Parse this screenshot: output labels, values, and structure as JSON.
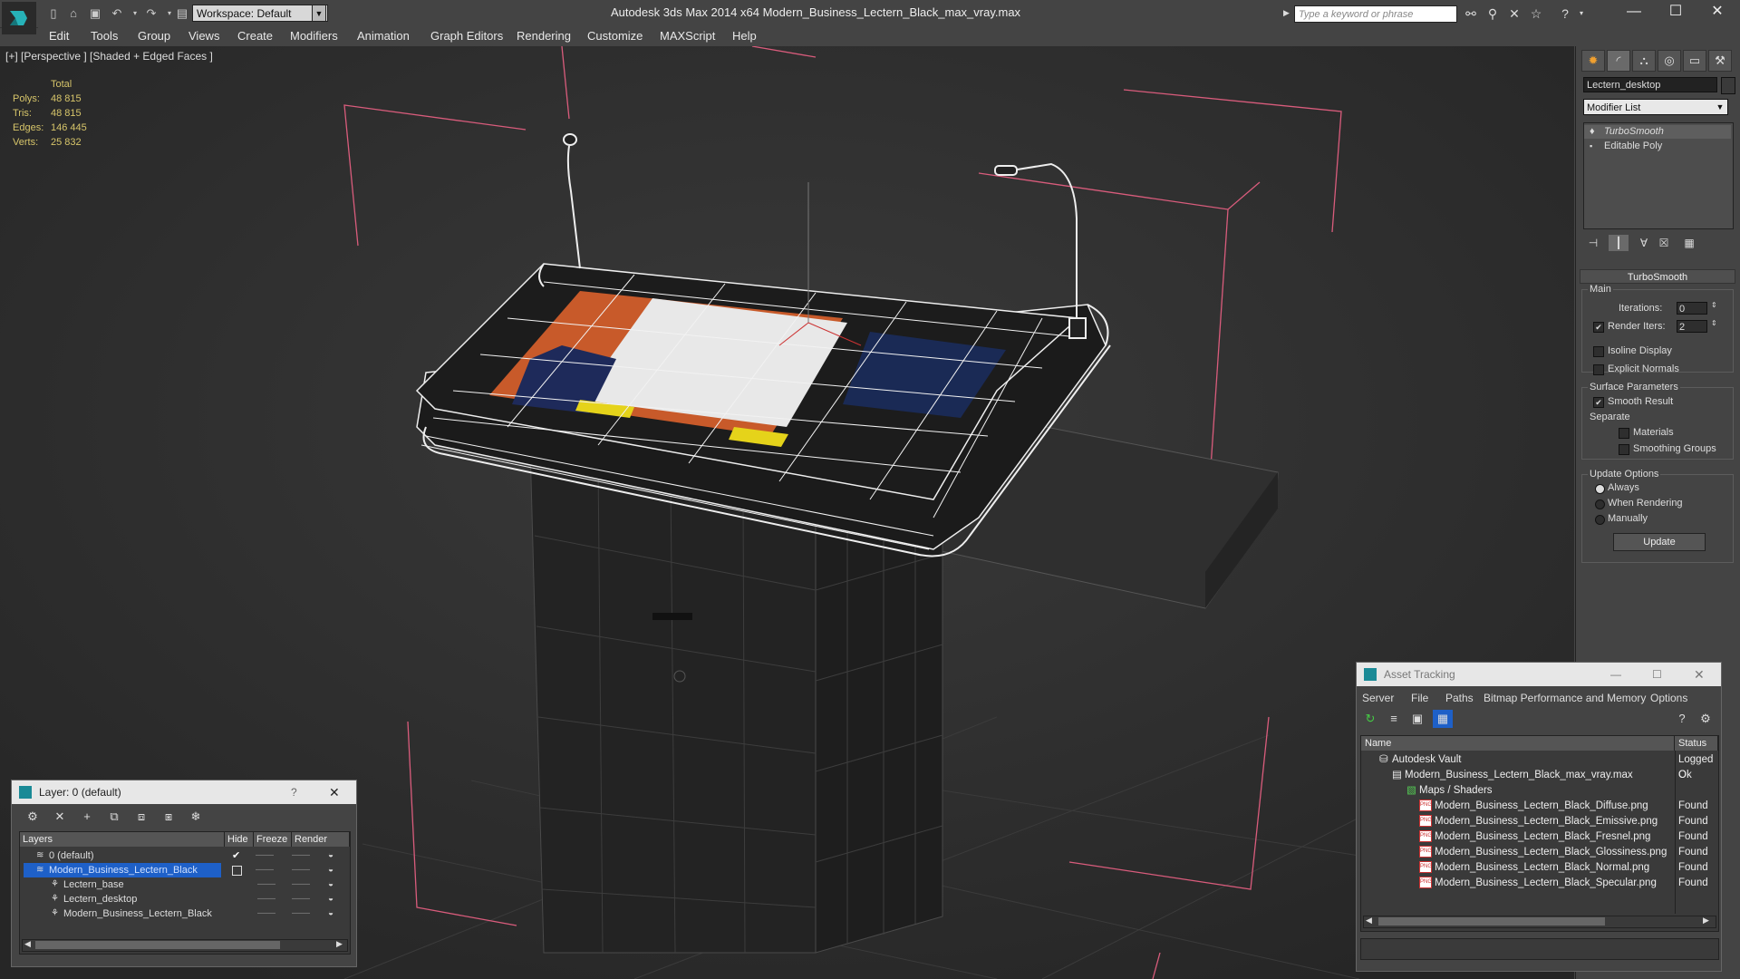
{
  "titlebar": {
    "app_title": "Autodesk 3ds Max  2014 x64     Modern_Business_Lectern_Black_max_vray.max",
    "workspace": "Workspace: Default",
    "search_placeholder": "Type a keyword or phrase"
  },
  "menu": [
    "Edit",
    "Tools",
    "Group",
    "Views",
    "Create",
    "Modifiers",
    "Animation",
    "Graph Editors",
    "Rendering",
    "Customize",
    "MAXScript",
    "Help"
  ],
  "viewport": {
    "label": "[+] [Perspective ] [Shaded + Edged Faces ]",
    "stats": {
      "header": "Total",
      "rows": [
        {
          "label": "Polys:",
          "value": "48 815"
        },
        {
          "label": "Tris:",
          "value": "48 815"
        },
        {
          "label": "Edges:",
          "value": "146 445"
        },
        {
          "label": "Verts:",
          "value": "25 832"
        }
      ]
    }
  },
  "command_panel": {
    "object_name": "Lectern_desktop",
    "modifier_list": "Modifier List",
    "stack": [
      "TurboSmooth",
      "Editable Poly"
    ],
    "turbosmooth": {
      "title": "TurboSmooth",
      "main_label": "Main",
      "iterations_label": "Iterations:",
      "iterations_value": "0",
      "render_iters_label": "Render Iters:",
      "render_iters_value": "2",
      "isoline_label": "Isoline Display",
      "explicit_label": "Explicit Normals",
      "surface_label": "Surface Parameters",
      "smooth_label": "Smooth Result",
      "separate_label": "Separate",
      "materials_label": "Materials",
      "smoothing_label": "Smoothing Groups",
      "update_options_label": "Update Options",
      "always_label": "Always",
      "when_rendering_label": "When Rendering",
      "manually_label": "Manually",
      "update_button": "Update"
    }
  },
  "layer_dialog": {
    "title": "Layer: 0 (default)",
    "help": "?",
    "columns": [
      "Layers",
      "Hide",
      "Freeze",
      "Render"
    ],
    "rows": [
      {
        "name": "0 (default)",
        "indent": 0
      },
      {
        "name": "Modern_Business_Lectern_Black",
        "indent": 0
      },
      {
        "name": "Lectern_base",
        "indent": 1
      },
      {
        "name": "Lectern_desktop",
        "indent": 1
      },
      {
        "name": "Modern_Business_Lectern_Black",
        "indent": 1
      }
    ]
  },
  "asset_dialog": {
    "title": "Asset Tracking",
    "menu": [
      "Server",
      "File",
      "Paths",
      "Bitmap Performance and Memory",
      "Options"
    ],
    "columns": [
      "Name",
      "Status"
    ],
    "rows": [
      {
        "name": "Autodesk Vault",
        "status": "Logged O",
        "indent": 1
      },
      {
        "name": "Modern_Business_Lectern_Black_max_vray.max",
        "status": "Ok",
        "indent": 2
      },
      {
        "name": "Maps / Shaders",
        "status": "",
        "indent": 3
      },
      {
        "name": "Modern_Business_Lectern_Black_Diffuse.png",
        "status": "Found",
        "indent": 4
      },
      {
        "name": "Modern_Business_Lectern_Black_Emissive.png",
        "status": "Found",
        "indent": 4
      },
      {
        "name": "Modern_Business_Lectern_Black_Fresnel.png",
        "status": "Found",
        "indent": 4
      },
      {
        "name": "Modern_Business_Lectern_Black_Glossiness.png",
        "status": "Found",
        "indent": 4
      },
      {
        "name": "Modern_Business_Lectern_Black_Normal.png",
        "status": "Found",
        "indent": 4
      },
      {
        "name": "Modern_Business_Lectern_Black_Specular.png",
        "status": "Found",
        "indent": 4
      }
    ]
  },
  "colors": {
    "accent": "#1e60c8",
    "stats_text": "#d7c56a",
    "bbox_lines": "#d95c7c"
  }
}
